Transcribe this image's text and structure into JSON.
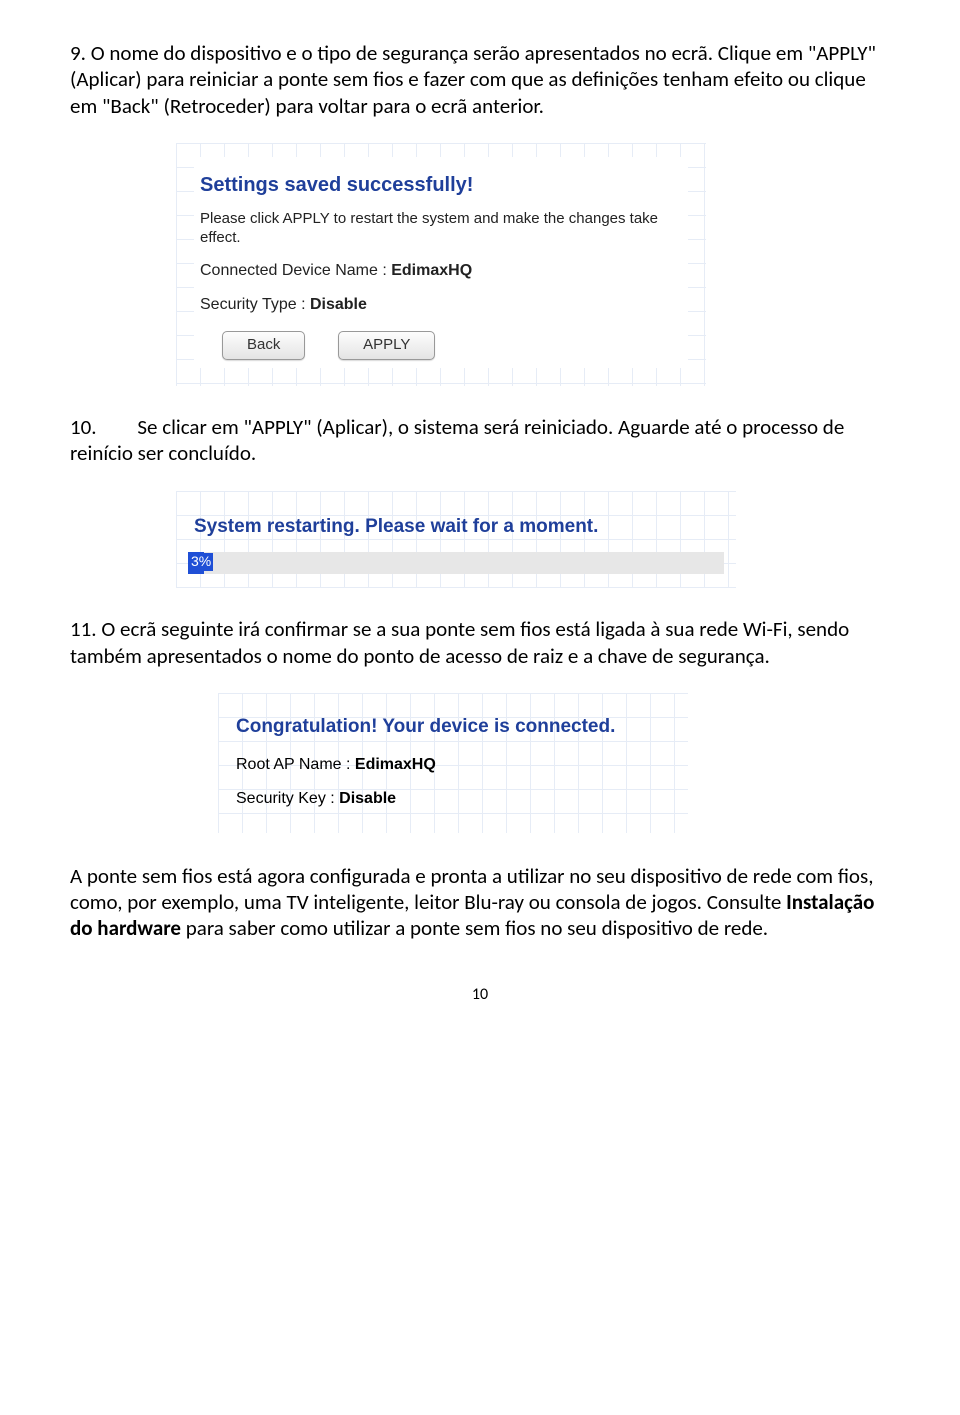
{
  "step9": {
    "num": "9.",
    "text_a": "O nome do dispositivo e o tipo de segurança serão apresentados no ecrã. Clique em \"APPLY\" (Aplicar) para reiniciar a ponte sem fios e fazer com que as definições tenham efeito ou clique em \"Back\" (Retroceder) para voltar para o ecrã anterior."
  },
  "panel1": {
    "headline": "Settings saved successfully!",
    "note": "Please click APPLY to restart the system and make the changes take effect.",
    "device_label": "Connected Device Name :",
    "device_value": "EdimaxHQ",
    "sec_label": "Security Type :",
    "sec_value": "Disable",
    "btn_back": "Back",
    "btn_apply": "APPLY"
  },
  "step10": {
    "num": "10.",
    "text": "Se clicar em \"APPLY\" (Aplicar), o sistema será reiniciado. Aguarde até o processo de reinício ser concluído."
  },
  "panel2": {
    "msg": "System restarting. Please wait for a moment.",
    "pct": "3%"
  },
  "step11": {
    "num": "11.",
    "text": "O ecrã seguinte irá confirmar se a sua ponte sem fios está ligada à sua rede Wi-Fi, sendo também apresentados o nome do ponto de acesso de raiz e a chave de segurança."
  },
  "panel3": {
    "headline": "Congratulation! Your device is connected.",
    "ap_label": "Root AP Name :",
    "ap_value": "EdimaxHQ",
    "key_label": "Security Key :",
    "key_value": "Disable"
  },
  "final": {
    "part1": "A ponte sem fios está agora configurada e pronta a utilizar no seu dispositivo de rede com fios, como, por exemplo, uma TV inteligente, leitor Blu-ray ou consola de jogos. Consulte ",
    "bold": "Instalação do hardware",
    "part2": " para saber como utilizar a ponte sem fios no seu dispositivo de rede."
  },
  "page_number": "10"
}
